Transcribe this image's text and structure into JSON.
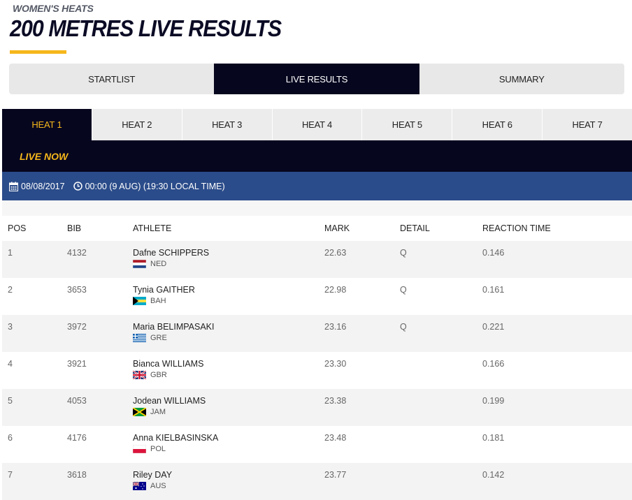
{
  "header": {
    "subtitle": "WOMEN'S HEATS",
    "title": "200 METRES LIVE RESULTS"
  },
  "view_tabs": [
    {
      "label": "STARTLIST",
      "active": false
    },
    {
      "label": "LIVE RESULTS",
      "active": true
    },
    {
      "label": "SUMMARY",
      "active": false
    }
  ],
  "heat_tabs": [
    {
      "label": "HEAT 1",
      "active": true
    },
    {
      "label": "HEAT 2",
      "active": false
    },
    {
      "label": "HEAT 3",
      "active": false
    },
    {
      "label": "HEAT 4",
      "active": false
    },
    {
      "label": "HEAT 5",
      "active": false
    },
    {
      "label": "HEAT 6",
      "active": false
    },
    {
      "label": "HEAT 7",
      "active": false
    }
  ],
  "live_status": "LIVE NOW",
  "event_info": {
    "date": "08/08/2017",
    "time": "00:00 (9 AUG) (19:30 LOCAL TIME)",
    "date_icon": "calendar-icon",
    "time_icon": "clock-icon"
  },
  "table": {
    "columns": [
      "POS",
      "BIB",
      "ATHLETE",
      "MARK",
      "DETAIL",
      "REACTION TIME"
    ],
    "rows": [
      {
        "pos": "1",
        "bib": "4132",
        "athlete": "Dafne SCHIPPERS",
        "country": "NED",
        "mark": "22.63",
        "detail": "Q",
        "reaction": "0.146"
      },
      {
        "pos": "2",
        "bib": "3653",
        "athlete": "Tynia GAITHER",
        "country": "BAH",
        "mark": "22.98",
        "detail": "Q",
        "reaction": "0.161"
      },
      {
        "pos": "3",
        "bib": "3972",
        "athlete": "Maria BELIMPASAKI",
        "country": "GRE",
        "mark": "23.16",
        "detail": "Q",
        "reaction": "0.221"
      },
      {
        "pos": "4",
        "bib": "3921",
        "athlete": "Bianca WILLIAMS",
        "country": "GBR",
        "mark": "23.30",
        "detail": "",
        "reaction": "0.166"
      },
      {
        "pos": "5",
        "bib": "4053",
        "athlete": "Jodean WILLIAMS",
        "country": "JAM",
        "mark": "23.38",
        "detail": "",
        "reaction": "0.199"
      },
      {
        "pos": "6",
        "bib": "4176",
        "athlete": "Anna KIELBASINSKA",
        "country": "POL",
        "mark": "23.48",
        "detail": "",
        "reaction": "0.181"
      },
      {
        "pos": "7",
        "bib": "3618",
        "athlete": "Riley DAY",
        "country": "AUS",
        "mark": "23.77",
        "detail": "",
        "reaction": "0.142"
      }
    ]
  },
  "colors": {
    "accent": "#f6b71b",
    "navy": "#06061f",
    "date_bar": "#2b4c8a"
  }
}
